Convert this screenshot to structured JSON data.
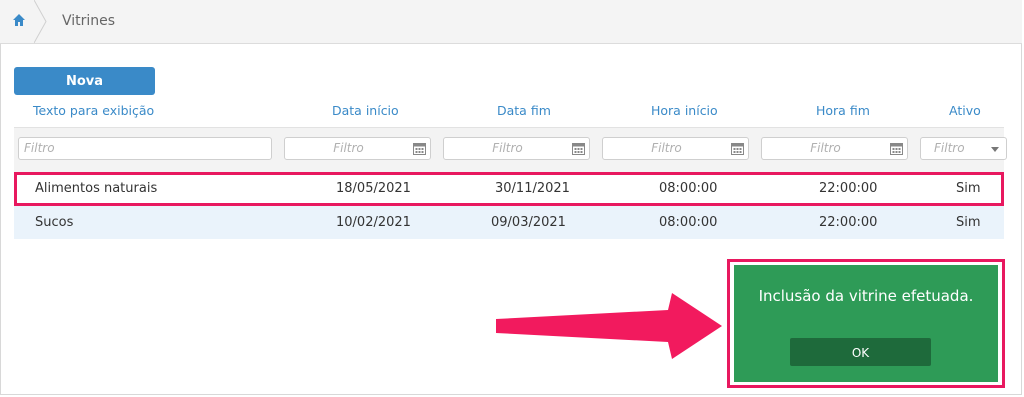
{
  "breadcrumb": {
    "home_icon": "home-icon",
    "current": "Vitrines"
  },
  "toolbar": {
    "new_label": "Nova"
  },
  "table": {
    "headers": [
      "Texto para exibição",
      "Data início",
      "Data fim",
      "Hora início",
      "Hora fim",
      "Ativo"
    ],
    "filter_placeholder": "Filtro",
    "rows": [
      [
        "Alimentos naturais",
        "18/05/2021",
        "30/11/2021",
        "08:00:00",
        "22:00:00",
        "Sim"
      ],
      [
        "Sucos",
        "10/02/2021",
        "09/03/2021",
        "08:00:00",
        "22:00:00",
        "Sim"
      ]
    ]
  },
  "toast": {
    "message": "Inclusão da vitrine efetuada.",
    "ok_label": "OK"
  },
  "colors": {
    "accent": "#3a8ac8",
    "success": "#2e9b57",
    "highlight": "#e8185f"
  }
}
